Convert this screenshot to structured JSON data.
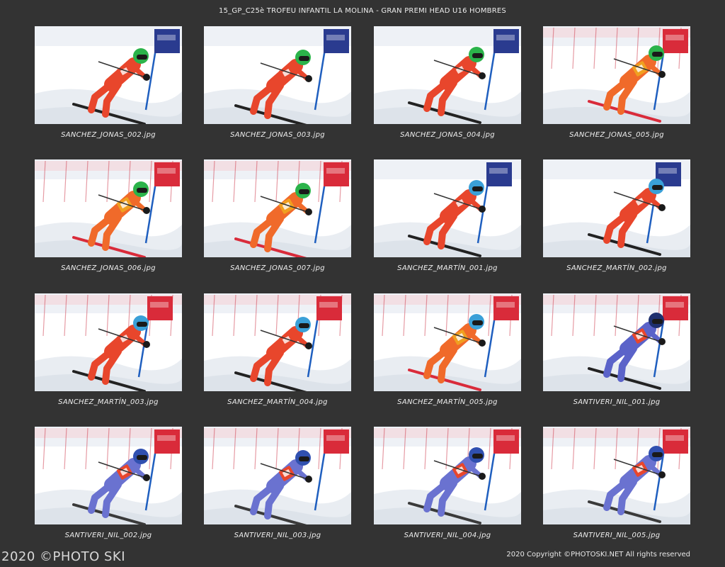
{
  "header": {
    "title": "15_GP_C25è TROFEU INFANTIL LA MOLINA - GRAN PREMI HEAD U16 HOMBRES"
  },
  "thumbnails": [
    {
      "caption": "SANCHEZ_JONAS_002.jpg",
      "suit": "#e8462c",
      "helmet": "#2bb34a",
      "ski": "#222222",
      "flag": "#2a3b8f",
      "bib": "#e8462c"
    },
    {
      "caption": "SANCHEZ_JONAS_003.jpg",
      "suit": "#e8462c",
      "helmet": "#2bb34a",
      "ski": "#222222",
      "flag": "#2a3b8f",
      "bib": "#e8462c"
    },
    {
      "caption": "SANCHEZ_JONAS_004.jpg",
      "suit": "#e8462c",
      "helmet": "#2bb34a",
      "ski": "#222222",
      "flag": "#2a3b8f",
      "bib": "#e8462c"
    },
    {
      "caption": "SANCHEZ_JONAS_005.jpg",
      "suit": "#f06a2a",
      "helmet": "#2bb34a",
      "ski": "#d92b3a",
      "flag": "#d92b3a",
      "bib": "#f0a020"
    },
    {
      "caption": "SANCHEZ_JONAS_006.jpg",
      "suit": "#f06a2a",
      "helmet": "#2bb34a",
      "ski": "#d92b3a",
      "flag": "#d92b3a",
      "bib": "#f0a020"
    },
    {
      "caption": "SANCHEZ_JONAS_007.jpg",
      "suit": "#f06a2a",
      "helmet": "#2bb34a",
      "ski": "#d92b3a",
      "flag": "#d92b3a",
      "bib": "#f0a020"
    },
    {
      "caption": "SANCHEZ_MARTÍN_001.jpg",
      "suit": "#e8462c",
      "helmet": "#3aa0d8",
      "ski": "#222222",
      "flag": "#2a3b8f",
      "bib": "#e8462c"
    },
    {
      "caption": "SANCHEZ_MARTÍN_002.jpg",
      "suit": "#e8462c",
      "helmet": "#3aa0d8",
      "ski": "#222222",
      "flag": "#2a3b8f",
      "bib": "#e8462c"
    },
    {
      "caption": "SANCHEZ_MARTÍN_003.jpg",
      "suit": "#e8462c",
      "helmet": "#3aa0d8",
      "ski": "#222222",
      "flag": "#d92b3a",
      "bib": "#e8462c"
    },
    {
      "caption": "SANCHEZ_MARTÍN_004.jpg",
      "suit": "#e8462c",
      "helmet": "#3aa0d8",
      "ski": "#222222",
      "flag": "#d92b3a",
      "bib": "#e8462c"
    },
    {
      "caption": "SANCHEZ_MARTÍN_005.jpg",
      "suit": "#f06a2a",
      "helmet": "#3aa0d8",
      "ski": "#d92b3a",
      "flag": "#d92b3a",
      "bib": "#f0a020"
    },
    {
      "caption": "SANTIVERI_NIL_001.jpg",
      "suit": "#5b63c9",
      "helmet": "#1e2f6e",
      "ski": "#222222",
      "flag": "#d92b3a",
      "bib": "#e8462c"
    },
    {
      "caption": "SANTIVERI_NIL_002.jpg",
      "suit": "#6a72d0",
      "helmet": "#3050b0",
      "ski": "#3a3a3a",
      "flag": "#d92b3a",
      "bib": "#e8462c"
    },
    {
      "caption": "SANTIVERI_NIL_003.jpg",
      "suit": "#6a72d0",
      "helmet": "#3050b0",
      "ski": "#3a3a3a",
      "flag": "#d92b3a",
      "bib": "#e8462c"
    },
    {
      "caption": "SANTIVERI_NIL_004.jpg",
      "suit": "#6a72d0",
      "helmet": "#3050b0",
      "ski": "#3a3a3a",
      "flag": "#d92b3a",
      "bib": "#e8462c"
    },
    {
      "caption": "SANTIVERI_NIL_005.jpg",
      "suit": "#6a72d0",
      "helmet": "#3050b0",
      "ski": "#3a3a3a",
      "flag": "#d92b3a",
      "bib": "#e8462c"
    }
  ],
  "footer": {
    "watermark": "2020 ©PHOTO SKI",
    "copyright": "2020 Copyright ©PHOTOSKI.NET All rights reserved"
  },
  "colors": {
    "background": "#333333",
    "text": "#eeeeee"
  }
}
